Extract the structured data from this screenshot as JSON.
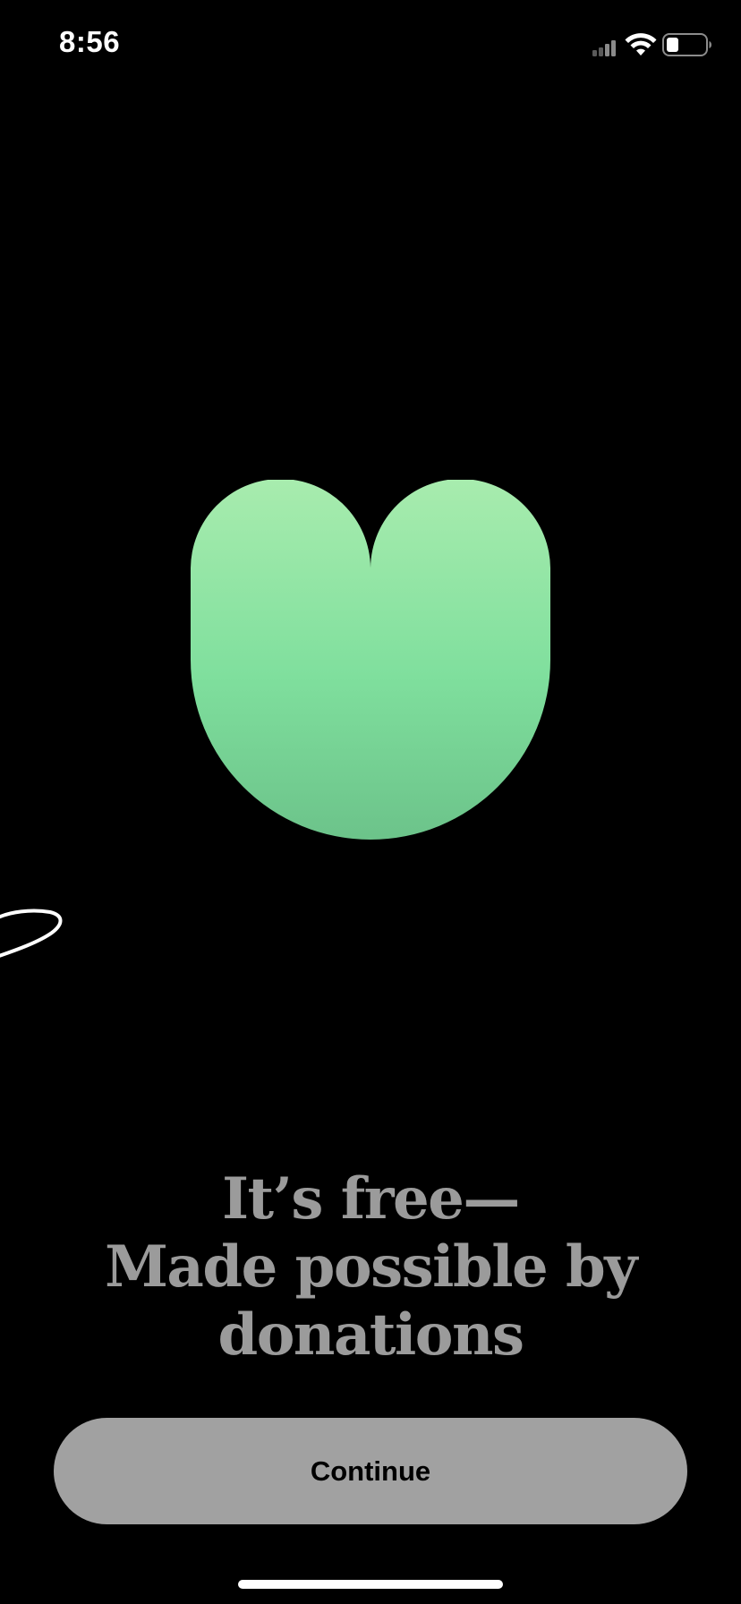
{
  "status_bar": {
    "time": "8:56",
    "signal_icon": "cellular-signal-icon",
    "wifi_icon": "wifi-icon",
    "battery_icon": "battery-icon",
    "battery_level": 0.3
  },
  "hero": {
    "logo_icon": "heart-shaped-logo",
    "logo_gradient": [
      "#a8ecae",
      "#7fdf9d",
      "#6cc38a"
    ],
    "decoration": "squiggle-line"
  },
  "headline": {
    "line1": "It’s free—",
    "line2": "Made possible by",
    "line3": "donations"
  },
  "actions": {
    "continue_label": "Continue"
  },
  "colors": {
    "background": "#000000",
    "headline_text": "#9b9b9b",
    "button_fill": "#a1a1a1",
    "button_text": "#000000"
  }
}
